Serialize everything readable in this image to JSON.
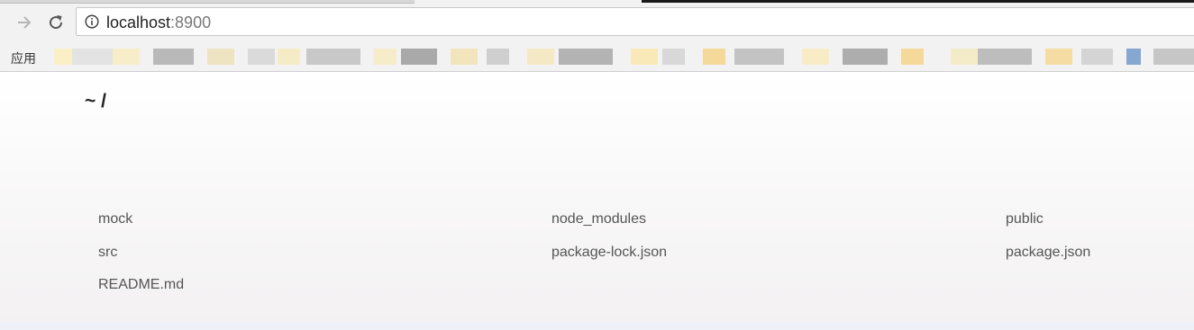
{
  "browser": {
    "url_host": "localhost",
    "url_port": ":8900",
    "bookmarks_apps_label": "应用"
  },
  "listing": {
    "path": "~ /",
    "files": [
      {
        "name": "mock"
      },
      {
        "name": "node_modules"
      },
      {
        "name": "public"
      },
      {
        "name": "src"
      },
      {
        "name": "package-lock.json"
      },
      {
        "name": "package.json"
      },
      {
        "name": "README.md"
      }
    ]
  },
  "colors": {
    "toolbar_bg": "#f2f2f2",
    "link_text": "#555555",
    "title_text": "#222222"
  },
  "icons": [
    "forward-arrow-icon",
    "reload-icon",
    "info-icon"
  ]
}
